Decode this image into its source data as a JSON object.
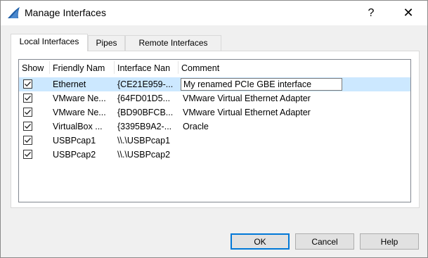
{
  "window": {
    "title": "Manage Interfaces",
    "help_glyph": "?",
    "close_glyph": "✕",
    "app_icon": "wireshark-fin-icon"
  },
  "tabs": [
    {
      "label": "Local Interfaces",
      "active": true
    },
    {
      "label": "Pipes",
      "active": false
    },
    {
      "label": "Remote Interfaces",
      "active": false
    }
  ],
  "table": {
    "columns": [
      "Show",
      "Friendly Nam",
      "Interface Nan",
      "Comment"
    ],
    "rows": [
      {
        "show": true,
        "friendly": "Ethernet",
        "iface": "{CE21E959-...",
        "comment": "My renamed PCIe GBE interface",
        "selected": true,
        "editing": true
      },
      {
        "show": true,
        "friendly": "VMware Ne...",
        "iface": "{64FD01D5...",
        "comment": "VMware Virtual Ethernet Adapter"
      },
      {
        "show": true,
        "friendly": "VMware Ne...",
        "iface": "{BD90BFCB...",
        "comment": "VMware Virtual Ethernet Adapter"
      },
      {
        "show": true,
        "friendly": "VirtualBox ...",
        "iface": "{3395B9A2-...",
        "comment": "Oracle"
      },
      {
        "show": true,
        "friendly": "USBPcap1",
        "iface": "\\\\.\\USBPcap1",
        "comment": ""
      },
      {
        "show": true,
        "friendly": "USBPcap2",
        "iface": "\\\\.\\USBPcap2",
        "comment": ""
      }
    ]
  },
  "buttons": {
    "ok": "OK",
    "cancel": "Cancel",
    "help": "Help"
  },
  "colors": {
    "selection": "#cce8ff",
    "default_button_border": "#0078d7",
    "icon_blue": "#1f5fa8"
  }
}
